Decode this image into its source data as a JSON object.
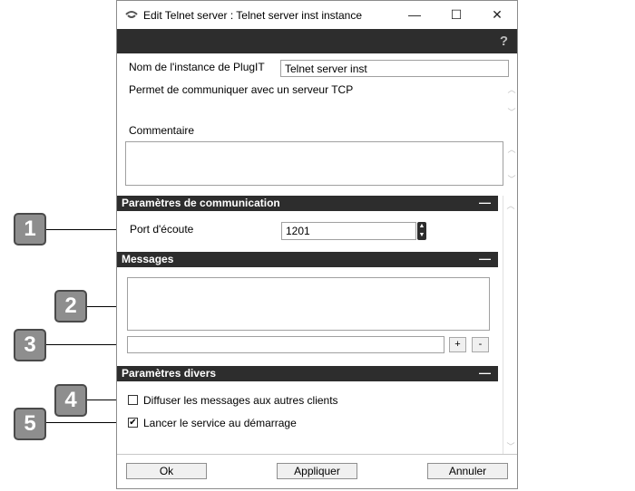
{
  "window": {
    "title": "Edit Telnet server : Telnet server inst instance",
    "controls": {
      "minimize": "—",
      "maximize": "☐",
      "close": "✕"
    },
    "help": "?"
  },
  "form": {
    "instance_name_label": "Nom de l'instance de PlugIT",
    "instance_name_value": "Telnet server inst",
    "description": "Permet de communiquer avec un serveur TCP",
    "comment_label": "Commentaire",
    "comment_value": ""
  },
  "sections": {
    "communication": {
      "title": "Paramètres de communication",
      "collapse": "—"
    },
    "messages": {
      "title": "Messages",
      "collapse": "—"
    },
    "misc": {
      "title": "Paramètres divers",
      "collapse": "—"
    }
  },
  "communication": {
    "port_label": "Port d'écoute",
    "port_value": "1201"
  },
  "messages": {
    "list_value": "",
    "new_message_value": "",
    "add_label": "+",
    "remove_label": "-"
  },
  "misc": {
    "broadcast_label": "Diffuser les messages aux autres clients",
    "broadcast_checked": false,
    "autostart_label": "Lancer le service au démarrage",
    "autostart_checked": true,
    "check_mark": "✔"
  },
  "footer": {
    "ok_label": "Ok",
    "apply_label": "Appliquer",
    "cancel_label": "Annuler"
  },
  "callouts": [
    "1",
    "2",
    "3",
    "4",
    "5"
  ]
}
